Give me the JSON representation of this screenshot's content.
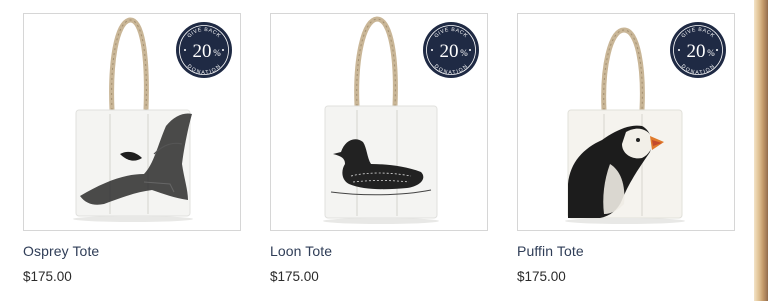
{
  "badge": {
    "top_text": "GIVE BACK",
    "value": "20",
    "percent": "%",
    "bottom_text": "DONATION",
    "color": "#1f2a44"
  },
  "products": [
    {
      "name": "Osprey Tote",
      "price": "$175.00",
      "design": "osprey"
    },
    {
      "name": "Loon Tote",
      "price": "$175.00",
      "design": "loon"
    },
    {
      "name": "Puffin Tote",
      "price": "$175.00",
      "design": "puffin"
    }
  ],
  "colors": {
    "title": "#2f3d57",
    "price": "#2b2b2b",
    "card_border": "#d6d6d6"
  }
}
